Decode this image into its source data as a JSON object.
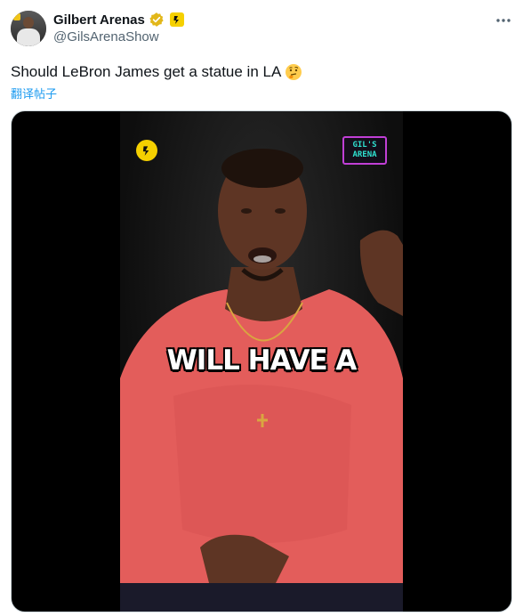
{
  "author": {
    "display_name": "Gilbert Arenas",
    "handle": "@GilsArenaShow"
  },
  "tweet": {
    "text": "Should LeBron James get a statue in LA",
    "translate_label": "翻译帖子"
  },
  "media": {
    "caption": "WILL HAVE A",
    "channel_logo_line1": "GIL'S",
    "channel_logo_line2": "ARENA"
  },
  "icons": {
    "verified": "verified-gold-badge-icon",
    "affiliate": "affiliate-badge-icon",
    "more": "more-options-icon",
    "emoji": "thinking-face-emoji"
  },
  "colors": {
    "verified_badge": "#e2b719",
    "affiliate_badge": "#f5d000",
    "link": "#1d9bf0",
    "handle_text": "#536471",
    "shirt": "#e35d5b"
  }
}
